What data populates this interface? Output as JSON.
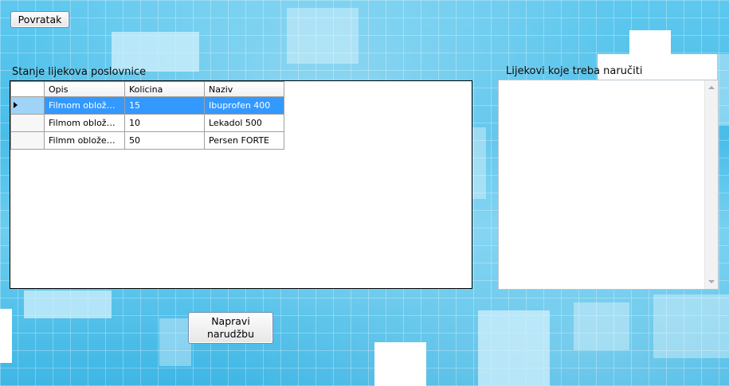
{
  "window": {
    "back_label": "Povratak",
    "stock_caption": "Stanje lijekova poslovnice",
    "order_caption": "Lijekovi koje treba naručiti",
    "order_button_label": "Napravi narudžbu"
  },
  "stock_grid": {
    "columns": [
      "Opis",
      "Kolicina",
      "Naziv"
    ],
    "rows": [
      {
        "opis": "Filmom obložene...",
        "kolicina": "15",
        "naziv": "Ibuprofen 400",
        "selected": true
      },
      {
        "opis": "Filmom obložene t...",
        "kolicina": "10",
        "naziv": "Lekadol 500",
        "selected": false
      },
      {
        "opis": "Filmm obložene t...",
        "kolicina": "50",
        "naziv": "Persen FORTE",
        "selected": false
      }
    ]
  },
  "order_list": {
    "items": []
  },
  "colors": {
    "selection": "#3399ff",
    "background": "#48bde9"
  }
}
